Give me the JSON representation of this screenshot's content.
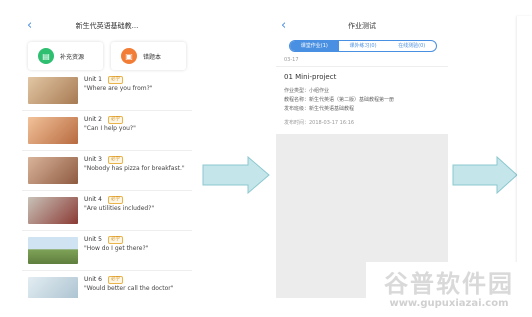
{
  "screen1": {
    "back_icon": "‹",
    "title": "新生代英语基础教...",
    "tiles": [
      {
        "label": "补充资源",
        "icon": "document-icon",
        "color": "#2fbf71",
        "glyph": "▤"
      },
      {
        "label": "错题本",
        "icon": "notebook-icon",
        "color": "#f27d37",
        "glyph": "▣"
      }
    ],
    "badge_text": "必学",
    "units": [
      {
        "name": "Unit 1",
        "quote": "\"Where are you from?\"",
        "thumb": "#c9a07a"
      },
      {
        "name": "Unit 2",
        "quote": "\"Can I help you?\"",
        "thumb": "#d28a5a"
      },
      {
        "name": "Unit 3",
        "quote": "\"Nobody has pizza for breakfast.\"",
        "thumb": "#b87b5c"
      },
      {
        "name": "Unit 4",
        "quote": "\"Are utilities included?\"",
        "thumb": "#9c4e46"
      },
      {
        "name": "Unit 5",
        "quote": "\"How do I get there?\"",
        "thumb": "#89a96a"
      },
      {
        "name": "Unit 6",
        "quote": "\"Would better call the doctor\"",
        "thumb": "#a0b8c8"
      }
    ]
  },
  "screen2": {
    "back_icon": "‹",
    "title": "作业测试",
    "tabs": [
      "课堂作业(1)",
      "课外练习(0)",
      "在线测验(0)"
    ],
    "date": "03-17",
    "hw_title": "01 Mini-project",
    "hw_lines": [
      "作业类型：小组作业",
      "教程名称：新生代英语（第二版）基础教程第一册",
      "发布班级：新生代英语基础教程",
      "发布时间：2018-03-17 16:16"
    ]
  },
  "watermark": {
    "cn": "谷普软件园",
    "url": "www.gupuxiazai.com"
  }
}
